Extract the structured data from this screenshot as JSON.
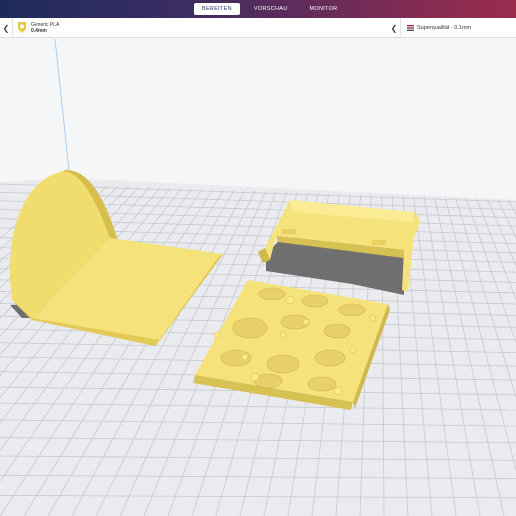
{
  "stages": [
    {
      "label": "BEREITEN",
      "active": true
    },
    {
      "label": "VORSCHAU",
      "active": false
    },
    {
      "label": "MONITOR",
      "active": false
    }
  ],
  "material": {
    "name": "Generic PLA",
    "nozzle": "0.4mm"
  },
  "quality": {
    "label": "Superqualität - 0.1mm"
  },
  "icons": {
    "back": "chevron-left-icon",
    "material": "spool-icon",
    "quality": "settings-sliders-icon"
  },
  "colors": {
    "model": "#f6e27a",
    "model_shade": "#d8c153",
    "shadow": "#6f6f6f",
    "plate": "#e9ebee",
    "grid": "#c9ccd1"
  }
}
